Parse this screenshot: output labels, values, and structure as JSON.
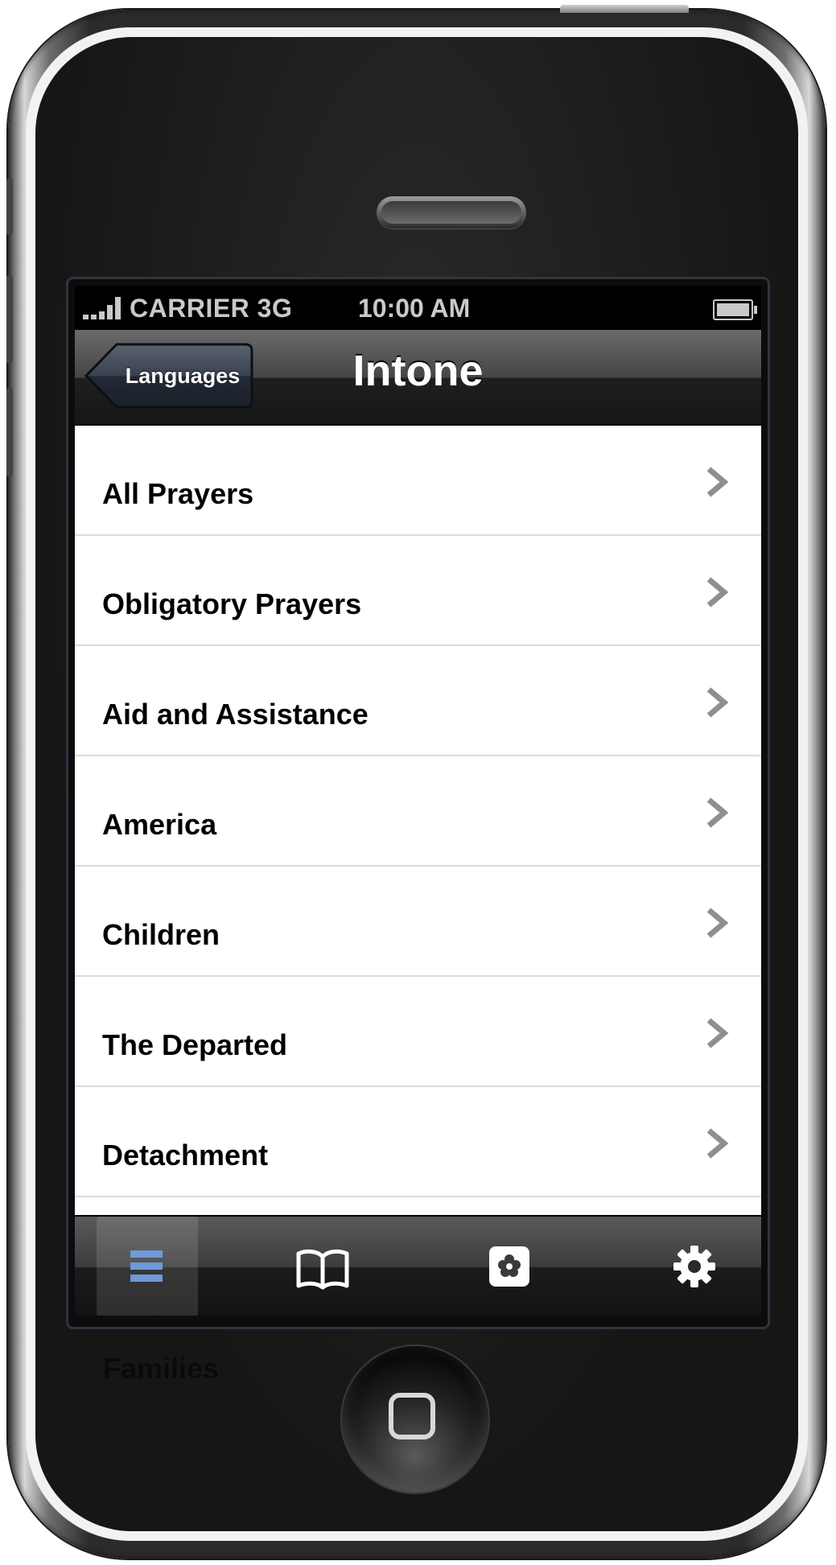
{
  "status_bar": {
    "carrier": "CARRIER 3G",
    "time": "10:00 AM",
    "signal_icon": "signal-bars-icon",
    "battery_icon": "battery-full-icon"
  },
  "nav_bar": {
    "back_label": "Languages",
    "title": "Intone"
  },
  "list": {
    "items": [
      {
        "label": "All Prayers"
      },
      {
        "label": "Obligatory Prayers"
      },
      {
        "label": "Aid and Assistance"
      },
      {
        "label": "America"
      },
      {
        "label": "Children"
      },
      {
        "label": "The Departed"
      },
      {
        "label": "Detachment"
      }
    ],
    "obscured_next_item": "Families",
    "chevron_icon": "chevron-right-icon"
  },
  "tab_bar": {
    "tabs": [
      {
        "icon": "list-icon",
        "selected": true
      },
      {
        "icon": "book-icon",
        "selected": false
      },
      {
        "icon": "flower-icon",
        "selected": false
      },
      {
        "icon": "gear-icon",
        "selected": false
      }
    ]
  },
  "colors": {
    "selected_tab_icon": "#6e9ad8",
    "tab_icon": "#ffffff",
    "chevron": "#8f8f8f",
    "status_text": "#c9c9c9",
    "nav_title": "#ffffff"
  }
}
